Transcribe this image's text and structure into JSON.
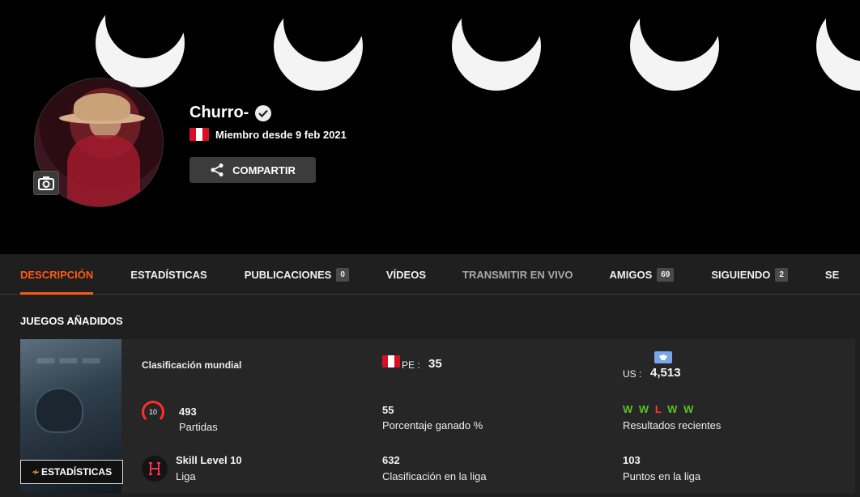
{
  "profile": {
    "name": "Churro-",
    "member_since": "Miembro desde 9 feb 2021",
    "share_label": "COMPARTIR",
    "colors": {
      "accent": "#ff5a12",
      "win": "#58c322",
      "loss": "#ff3b3b"
    }
  },
  "tabs": [
    {
      "label": "DESCRIPCIÓN",
      "count": null
    },
    {
      "label": "ESTADÍSTICAS",
      "count": null
    },
    {
      "label": "PUBLICACIONES",
      "count": "0"
    },
    {
      "label": "VÍDEOS",
      "count": null
    },
    {
      "label": "TRANSMITIR EN VIVO",
      "count": null
    },
    {
      "label": "AMIGOS",
      "count": "69"
    },
    {
      "label": "SIGUIENDO",
      "count": "2"
    },
    {
      "label": "SE",
      "count": null
    }
  ],
  "games_section": {
    "title": "JUEGOS AÑADIDOS"
  },
  "game": {
    "stats_button": "ESTADÍSTICAS",
    "world_ranking_label": "Clasificación mundial",
    "pe_label": "PE :",
    "pe_rank": "35",
    "us_label": "US :",
    "us_rank": "4,513",
    "matches_value": "493",
    "matches_label": "Partidas",
    "level_badge": "10",
    "win_rate_value": "55",
    "win_rate_label": "Porcentaje ganado %",
    "recent_results": [
      "W",
      "W",
      "L",
      "W",
      "W"
    ],
    "recent_results_label": "Resultados recientes",
    "skill_value": "Skill Level 10",
    "league_label": "Liga",
    "league_rank_value": "632",
    "league_rank_label": "Clasificación en la liga",
    "league_points_value": "103",
    "league_points_label": "Puntos en la liga"
  }
}
